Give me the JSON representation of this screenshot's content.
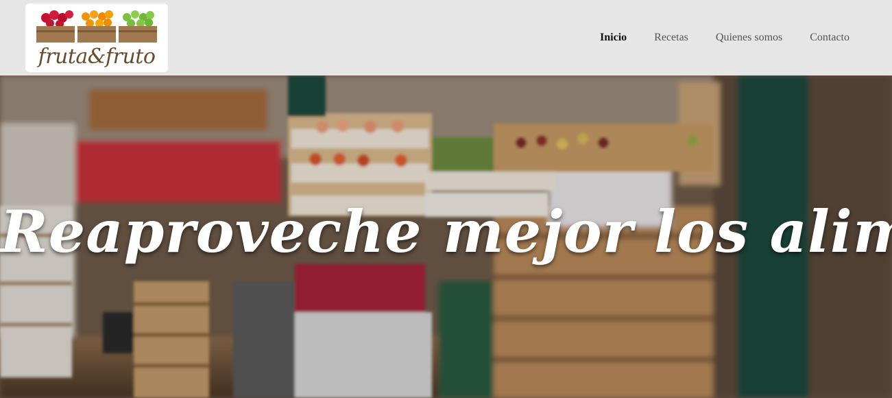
{
  "brand": {
    "name": "fruta&fruto"
  },
  "nav": {
    "items": [
      {
        "label": "Inicio",
        "active": true
      },
      {
        "label": "Recetas",
        "active": false
      },
      {
        "label": "Quienes somos",
        "active": false
      },
      {
        "label": "Contacto",
        "active": false
      }
    ]
  },
  "hero": {
    "headline": "Reaproveche mejor los alimentos",
    "background": "market-produce-photo"
  },
  "colors": {
    "header_bg": "#e6e6e6",
    "logo_text": "#6b4a2c",
    "nav_active": "#111111",
    "nav_inactive": "#555555"
  }
}
